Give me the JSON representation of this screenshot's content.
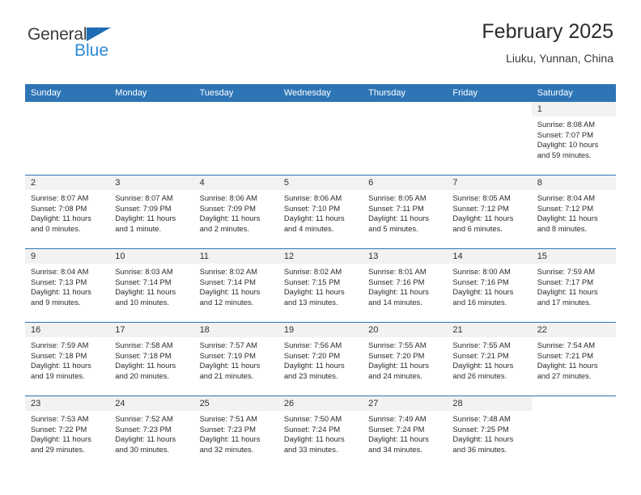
{
  "brand": {
    "name_top": "General",
    "name_bottom": "Blue",
    "triangle_color": "#1f6cb4",
    "blue_text_color": "#2e8bd6"
  },
  "header": {
    "title": "February 2025",
    "subtitle": "Liuku, Yunnan, China"
  },
  "theme": {
    "header_blue": "#2e75b6",
    "daynum_band": "#f2f2f2",
    "text": "#2b2b2b"
  },
  "calendar": {
    "weekdays": [
      "Sunday",
      "Monday",
      "Tuesday",
      "Wednesday",
      "Thursday",
      "Friday",
      "Saturday"
    ],
    "weeks": [
      [
        {
          "day": "",
          "sunrise": "",
          "sunset": "",
          "daylight_1": "",
          "daylight_2": ""
        },
        {
          "day": "",
          "sunrise": "",
          "sunset": "",
          "daylight_1": "",
          "daylight_2": ""
        },
        {
          "day": "",
          "sunrise": "",
          "sunset": "",
          "daylight_1": "",
          "daylight_2": ""
        },
        {
          "day": "",
          "sunrise": "",
          "sunset": "",
          "daylight_1": "",
          "daylight_2": ""
        },
        {
          "day": "",
          "sunrise": "",
          "sunset": "",
          "daylight_1": "",
          "daylight_2": ""
        },
        {
          "day": "",
          "sunrise": "",
          "sunset": "",
          "daylight_1": "",
          "daylight_2": ""
        },
        {
          "day": "1",
          "sunrise": "Sunrise: 8:08 AM",
          "sunset": "Sunset: 7:07 PM",
          "daylight_1": "Daylight: 10 hours",
          "daylight_2": "and 59 minutes."
        }
      ],
      [
        {
          "day": "2",
          "sunrise": "Sunrise: 8:07 AM",
          "sunset": "Sunset: 7:08 PM",
          "daylight_1": "Daylight: 11 hours",
          "daylight_2": "and 0 minutes."
        },
        {
          "day": "3",
          "sunrise": "Sunrise: 8:07 AM",
          "sunset": "Sunset: 7:09 PM",
          "daylight_1": "Daylight: 11 hours",
          "daylight_2": "and 1 minute."
        },
        {
          "day": "4",
          "sunrise": "Sunrise: 8:06 AM",
          "sunset": "Sunset: 7:09 PM",
          "daylight_1": "Daylight: 11 hours",
          "daylight_2": "and 2 minutes."
        },
        {
          "day": "5",
          "sunrise": "Sunrise: 8:06 AM",
          "sunset": "Sunset: 7:10 PM",
          "daylight_1": "Daylight: 11 hours",
          "daylight_2": "and 4 minutes."
        },
        {
          "day": "6",
          "sunrise": "Sunrise: 8:05 AM",
          "sunset": "Sunset: 7:11 PM",
          "daylight_1": "Daylight: 11 hours",
          "daylight_2": "and 5 minutes."
        },
        {
          "day": "7",
          "sunrise": "Sunrise: 8:05 AM",
          "sunset": "Sunset: 7:12 PM",
          "daylight_1": "Daylight: 11 hours",
          "daylight_2": "and 6 minutes."
        },
        {
          "day": "8",
          "sunrise": "Sunrise: 8:04 AM",
          "sunset": "Sunset: 7:12 PM",
          "daylight_1": "Daylight: 11 hours",
          "daylight_2": "and 8 minutes."
        }
      ],
      [
        {
          "day": "9",
          "sunrise": "Sunrise: 8:04 AM",
          "sunset": "Sunset: 7:13 PM",
          "daylight_1": "Daylight: 11 hours",
          "daylight_2": "and 9 minutes."
        },
        {
          "day": "10",
          "sunrise": "Sunrise: 8:03 AM",
          "sunset": "Sunset: 7:14 PM",
          "daylight_1": "Daylight: 11 hours",
          "daylight_2": "and 10 minutes."
        },
        {
          "day": "11",
          "sunrise": "Sunrise: 8:02 AM",
          "sunset": "Sunset: 7:14 PM",
          "daylight_1": "Daylight: 11 hours",
          "daylight_2": "and 12 minutes."
        },
        {
          "day": "12",
          "sunrise": "Sunrise: 8:02 AM",
          "sunset": "Sunset: 7:15 PM",
          "daylight_1": "Daylight: 11 hours",
          "daylight_2": "and 13 minutes."
        },
        {
          "day": "13",
          "sunrise": "Sunrise: 8:01 AM",
          "sunset": "Sunset: 7:16 PM",
          "daylight_1": "Daylight: 11 hours",
          "daylight_2": "and 14 minutes."
        },
        {
          "day": "14",
          "sunrise": "Sunrise: 8:00 AM",
          "sunset": "Sunset: 7:16 PM",
          "daylight_1": "Daylight: 11 hours",
          "daylight_2": "and 16 minutes."
        },
        {
          "day": "15",
          "sunrise": "Sunrise: 7:59 AM",
          "sunset": "Sunset: 7:17 PM",
          "daylight_1": "Daylight: 11 hours",
          "daylight_2": "and 17 minutes."
        }
      ],
      [
        {
          "day": "16",
          "sunrise": "Sunrise: 7:59 AM",
          "sunset": "Sunset: 7:18 PM",
          "daylight_1": "Daylight: 11 hours",
          "daylight_2": "and 19 minutes."
        },
        {
          "day": "17",
          "sunrise": "Sunrise: 7:58 AM",
          "sunset": "Sunset: 7:18 PM",
          "daylight_1": "Daylight: 11 hours",
          "daylight_2": "and 20 minutes."
        },
        {
          "day": "18",
          "sunrise": "Sunrise: 7:57 AM",
          "sunset": "Sunset: 7:19 PM",
          "daylight_1": "Daylight: 11 hours",
          "daylight_2": "and 21 minutes."
        },
        {
          "day": "19",
          "sunrise": "Sunrise: 7:56 AM",
          "sunset": "Sunset: 7:20 PM",
          "daylight_1": "Daylight: 11 hours",
          "daylight_2": "and 23 minutes."
        },
        {
          "day": "20",
          "sunrise": "Sunrise: 7:55 AM",
          "sunset": "Sunset: 7:20 PM",
          "daylight_1": "Daylight: 11 hours",
          "daylight_2": "and 24 minutes."
        },
        {
          "day": "21",
          "sunrise": "Sunrise: 7:55 AM",
          "sunset": "Sunset: 7:21 PM",
          "daylight_1": "Daylight: 11 hours",
          "daylight_2": "and 26 minutes."
        },
        {
          "day": "22",
          "sunrise": "Sunrise: 7:54 AM",
          "sunset": "Sunset: 7:21 PM",
          "daylight_1": "Daylight: 11 hours",
          "daylight_2": "and 27 minutes."
        }
      ],
      [
        {
          "day": "23",
          "sunrise": "Sunrise: 7:53 AM",
          "sunset": "Sunset: 7:22 PM",
          "daylight_1": "Daylight: 11 hours",
          "daylight_2": "and 29 minutes."
        },
        {
          "day": "24",
          "sunrise": "Sunrise: 7:52 AM",
          "sunset": "Sunset: 7:23 PM",
          "daylight_1": "Daylight: 11 hours",
          "daylight_2": "and 30 minutes."
        },
        {
          "day": "25",
          "sunrise": "Sunrise: 7:51 AM",
          "sunset": "Sunset: 7:23 PM",
          "daylight_1": "Daylight: 11 hours",
          "daylight_2": "and 32 minutes."
        },
        {
          "day": "26",
          "sunrise": "Sunrise: 7:50 AM",
          "sunset": "Sunset: 7:24 PM",
          "daylight_1": "Daylight: 11 hours",
          "daylight_2": "and 33 minutes."
        },
        {
          "day": "27",
          "sunrise": "Sunrise: 7:49 AM",
          "sunset": "Sunset: 7:24 PM",
          "daylight_1": "Daylight: 11 hours",
          "daylight_2": "and 34 minutes."
        },
        {
          "day": "28",
          "sunrise": "Sunrise: 7:48 AM",
          "sunset": "Sunset: 7:25 PM",
          "daylight_1": "Daylight: 11 hours",
          "daylight_2": "and 36 minutes."
        },
        {
          "day": "",
          "sunrise": "",
          "sunset": "",
          "daylight_1": "",
          "daylight_2": ""
        }
      ]
    ]
  }
}
